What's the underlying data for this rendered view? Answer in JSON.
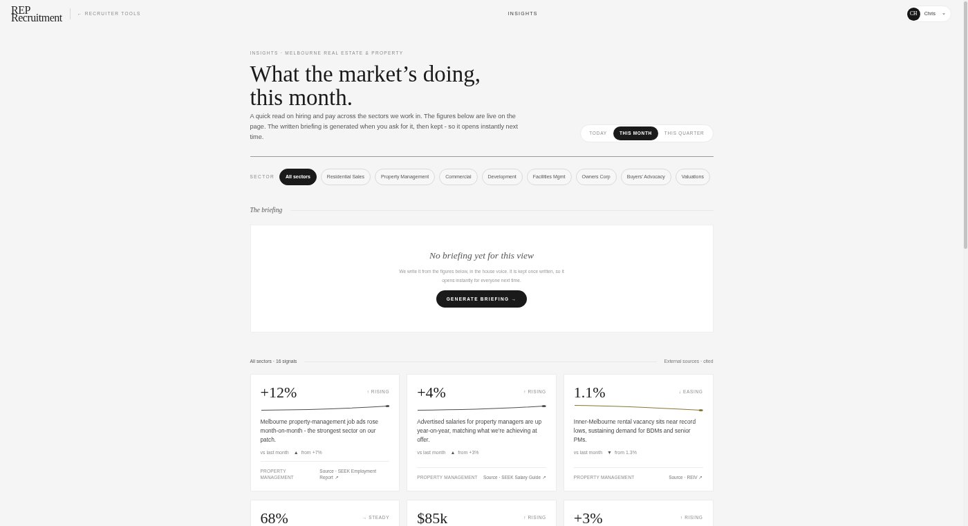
{
  "header": {
    "logo": [
      "REP",
      "Recruitment"
    ],
    "back_link": "← RECRUITER TOOLS",
    "title": "INSIGHTS",
    "user": {
      "initials": "CH",
      "name": "Chris"
    }
  },
  "intro": {
    "eyebrow": "INSIGHTS · MELBOURNE REAL ESTATE & PROPERTY",
    "title": "What the market’s doing, this month.",
    "description": "A quick read on hiring and pay across the sectors we work in. The figures below are live on the page. The written briefing is generated when you ask for it, then kept - so it opens instantly next time.",
    "periods": [
      {
        "label": "TODAY",
        "selected": false
      },
      {
        "label": "THIS MONTH",
        "selected": true
      },
      {
        "label": "THIS QUARTER",
        "selected": false
      }
    ]
  },
  "sector_filter": {
    "label": "SECTOR",
    "chips": [
      {
        "label": "All sectors",
        "selected": true
      },
      {
        "label": "Residential Sales",
        "selected": false
      },
      {
        "label": "Property Management",
        "selected": false
      },
      {
        "label": "Commercial",
        "selected": false
      },
      {
        "label": "Development",
        "selected": false
      },
      {
        "label": "Facilities Mgmt",
        "selected": false
      },
      {
        "label": "Owners Corp",
        "selected": false
      },
      {
        "label": "Buyers’ Advocacy",
        "selected": false
      },
      {
        "label": "Valuations",
        "selected": false
      }
    ]
  },
  "briefing": {
    "heading": "The briefing",
    "empty_title": "No briefing yet for this view",
    "empty_text": "We write it from the figures below, in the house voice. It is kept once written, so it opens instantly for everyone next time.",
    "button": "GENERATE BRIEFING →"
  },
  "signals": {
    "summary": "All sectors · 16 signals",
    "note": "External sources · cited",
    "cards": [
      {
        "kind": "rising",
        "value": "+12%",
        "trend": "↑ RISING",
        "description": "Melbourne property-management job ads rose month-on-month - the strongest sector on our patch.",
        "comparison": {
          "label": "vs last month",
          "arrow": "▲",
          "change": "from +7%"
        },
        "sector": "PROPERTY MANAGEMENT",
        "source": "Source · SEEK Employment Report ↗"
      },
      {
        "kind": "rising",
        "value": "+4%",
        "trend": "↑ RISING",
        "description": "Advertised salaries for property managers are up year-on-year, matching what we’re achieving at offer.",
        "comparison": {
          "label": "vs last month",
          "arrow": "▲",
          "change": "from +3%"
        },
        "sector": "PROPERTY MANAGEMENT",
        "source": "Source · SEEK Salary Guide ↗"
      },
      {
        "kind": "easing",
        "value": "1.1%",
        "trend": "↓ EASING",
        "description": "Inner-Melbourne rental vacancy sits near record lows, sustaining demand for BDMs and senior PMs.",
        "comparison": {
          "label": "vs last month",
          "arrow": "▼",
          "change": "from 1.3%"
        },
        "sector": "PROPERTY MANAGEMENT",
        "source": "Source · REIV ↗"
      },
      {
        "value": "68%",
        "trend": "→ STEADY"
      },
      {
        "value": "$85k",
        "trend": "↑ RISING"
      },
      {
        "value": "+3%",
        "trend": "↑ RISING"
      }
    ]
  }
}
